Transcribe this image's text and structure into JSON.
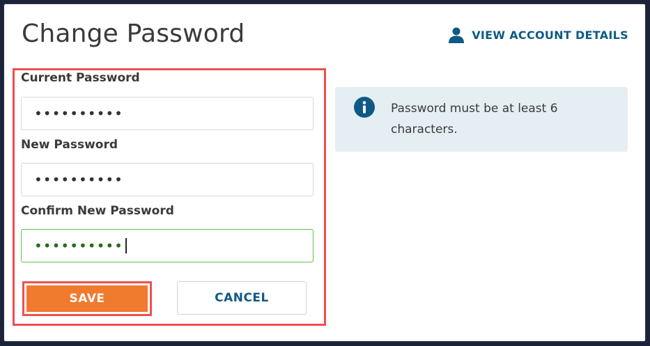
{
  "header": {
    "title": "Change Password",
    "account_link_label": "VIEW ACCOUNT DETAILS",
    "account_icon": "user-icon"
  },
  "form": {
    "current_password": {
      "label": "Current Password",
      "value": "••••••••••"
    },
    "new_password": {
      "label": "New Password",
      "value": "••••••••••"
    },
    "confirm_password": {
      "label": "Confirm New Password",
      "value": "••••••••••"
    },
    "save_label": "SAVE",
    "cancel_label": "CANCEL"
  },
  "info": {
    "icon": "info-icon",
    "text": "Password must be at least 6 characters."
  },
  "colors": {
    "accent_blue": "#0e5a84",
    "save_orange": "#f07a2e",
    "highlight_red": "#ef4f4f",
    "active_border_green": "#5cc04a",
    "info_bg": "#e5eef3"
  }
}
